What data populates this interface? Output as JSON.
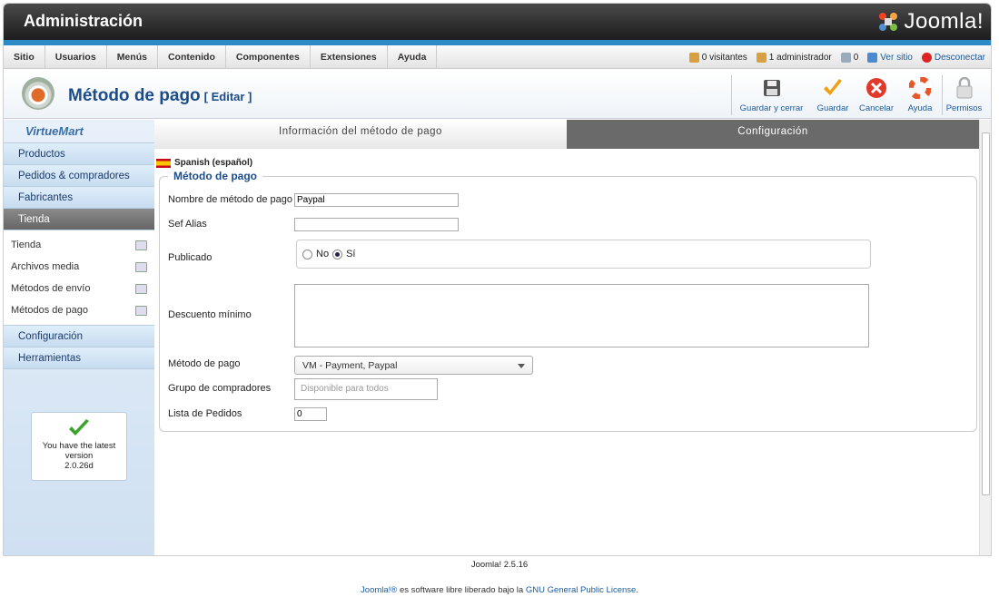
{
  "header": {
    "title": "Administración",
    "logo_text": "Joomla!"
  },
  "menu": [
    "Sitio",
    "Usuarios",
    "Menús",
    "Contenido",
    "Componentes",
    "Extensiones",
    "Ayuda"
  ],
  "status": {
    "visitors": "0 visitantes",
    "admins": "1 administrador",
    "messages": "0",
    "view_site": "Ver sitio",
    "logout": "Desconectar"
  },
  "page": {
    "title": "Método de pago",
    "edit": "[ Editar ]"
  },
  "toolbar": {
    "save_close": "Guardar y cerrar",
    "save": "Guardar",
    "cancel": "Cancelar",
    "help": "Ayuda",
    "permissions": "Permisos"
  },
  "sidebar": {
    "logo": "VirtueMart",
    "items": [
      "Productos",
      "Pedidos & compradores",
      "Fabricantes",
      "Tienda"
    ],
    "sub_items": [
      "Tienda",
      "Archivos media",
      "Métodos de envío",
      "Métodos de pago"
    ],
    "bottom_items": [
      "Configuración",
      "Herramientas"
    ],
    "version": {
      "line1": "You have the latest",
      "line2": "version",
      "line3": "2.0.26d"
    }
  },
  "tabs": {
    "info": "Información del método de pago",
    "config": "Configuración"
  },
  "form": {
    "language": "Spanish (español)",
    "legend": "Método de pago",
    "name_label": "Nombre de método de pago",
    "name_value": "Paypal",
    "alias_label": "Sef Alias",
    "alias_value": "",
    "published_label": "Publicado",
    "no": "No",
    "yes": "Sí",
    "discount_label": "Descuento mínimo",
    "method_label": "Método de pago",
    "method_value": "VM - Payment, Paypal",
    "group_label": "Grupo de compradores",
    "group_placeholder": "Disponible para todos",
    "orders_label": "Lista de Pedidos",
    "orders_value": "0"
  },
  "footer": {
    "version": "Joomla! 2.5.16",
    "license_prefix": "Joomla!® es software libre liberado bajo la",
    "license_link": "GNU General Public License",
    "license_suffix": "."
  }
}
